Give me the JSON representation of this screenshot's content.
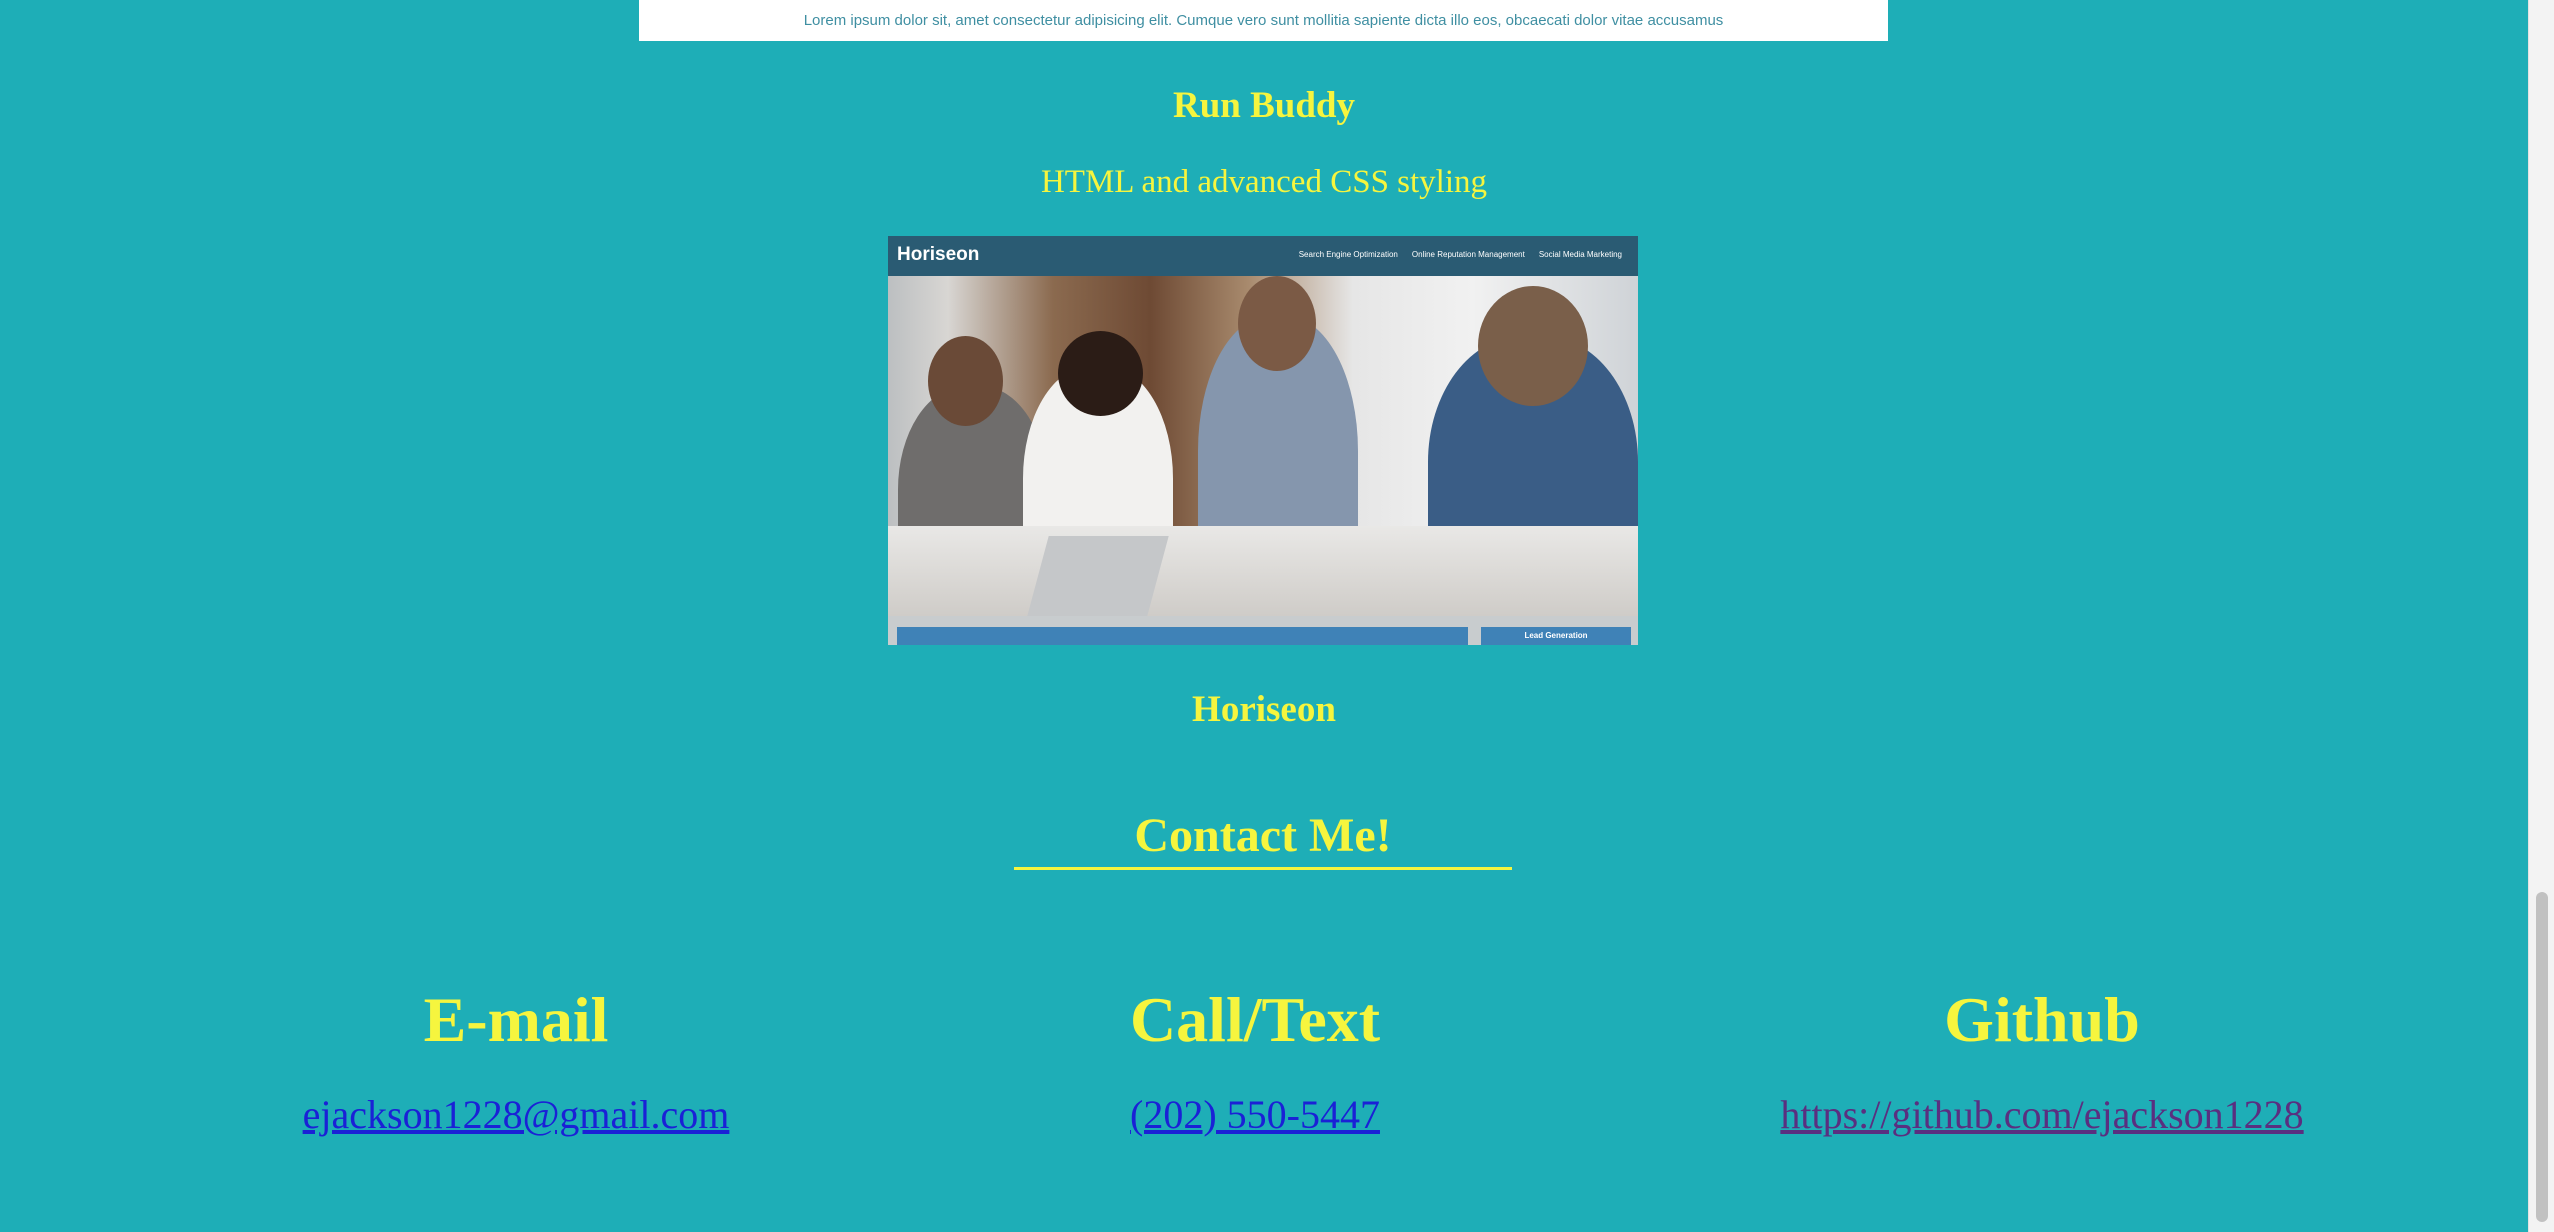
{
  "top_card": {
    "line1": "Lorem ipsum dolor sit, amet consectetur adipisicing elit. Cumque vero sunt mollitia sapiente dicta illo eos, obcaecati dolor vitae accusamus",
    "line2": "…"
  },
  "project": {
    "title": "Run Buddy",
    "description": "HTML and advanced CSS styling",
    "screenshot": {
      "logo": "Horiseon",
      "nav": [
        "Search Engine Optimization",
        "Online Reputation Management",
        "Social Media Marketing"
      ],
      "sidebar_button": "Lead Generation"
    },
    "caption": "Horiseon"
  },
  "contact": {
    "title": "Contact Me!",
    "email": {
      "heading": "E-mail",
      "link": "ejackson1228@gmail.com"
    },
    "call": {
      "heading": "Call/Text",
      "link": "(202) 550-5447"
    },
    "github": {
      "heading": "Github",
      "link": "https://github.com/ejackson1228"
    }
  },
  "colors": {
    "background": "#1eaeb7",
    "accent": "#f6f53e",
    "link": "#1a21d6",
    "visited_link": "#5a2f80"
  }
}
